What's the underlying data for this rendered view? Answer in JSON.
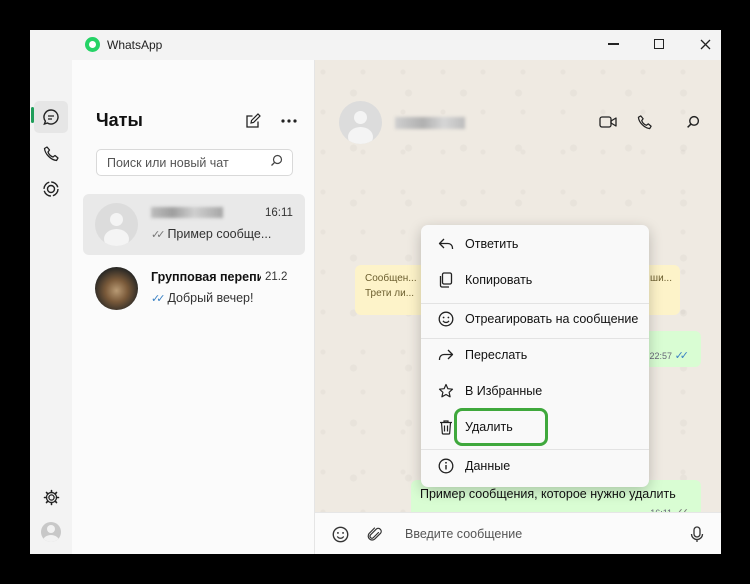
{
  "window": {
    "app_title": "WhatsApp"
  },
  "sidebar_rail": {
    "items": [
      {
        "name": "chats",
        "icon": "chat-bubble-icon",
        "active": true
      },
      {
        "name": "calls",
        "icon": "phone-icon",
        "active": false
      },
      {
        "name": "status",
        "icon": "status-ring-icon",
        "active": false
      }
    ],
    "bottom": [
      {
        "name": "settings",
        "icon": "gear-icon"
      },
      {
        "name": "profile",
        "icon": "avatar-icon"
      }
    ]
  },
  "chat_list": {
    "title": "Чаты",
    "search_placeholder": "Поиск или новый чат",
    "chats": [
      {
        "name": "",
        "time": "16:11",
        "preview": "Пример сообще...",
        "tick_color": "gray",
        "selected": true
      },
      {
        "name": "Групповая перепи",
        "time": "21.2",
        "preview": "Добрый вечер!",
        "tick_color": "blue",
        "selected": false
      }
    ]
  },
  "conversation": {
    "system_note": {
      "left": "Сообщен... Трети ли...",
      "right": "ием. ши..."
    },
    "messages": [
      {
        "text": "",
        "time": "22:57"
      },
      {
        "text": "Пример сообщения, которое нужно удалить",
        "time": "16:11"
      }
    ],
    "composer_placeholder": "Введите сообщение"
  },
  "context_menu": {
    "items": [
      {
        "label": "Ответить",
        "icon": "reply-icon"
      },
      {
        "label": "Копировать",
        "icon": "copy-icon"
      },
      {
        "label": "Отреагировать на сообщение",
        "icon": "smiley-icon"
      },
      {
        "label": "Переслать",
        "icon": "forward-icon"
      },
      {
        "label": "В Избранные",
        "icon": "star-icon"
      },
      {
        "label": "Удалить",
        "icon": "trash-icon",
        "highlighted": true
      },
      {
        "label": "Данные",
        "icon": "info-icon"
      }
    ]
  },
  "colors": {
    "accent": "#1f9e5a",
    "highlight_border": "#3fa83c",
    "bubble_out": "#d9fdd3",
    "read_ticks": "#3b82c4"
  }
}
